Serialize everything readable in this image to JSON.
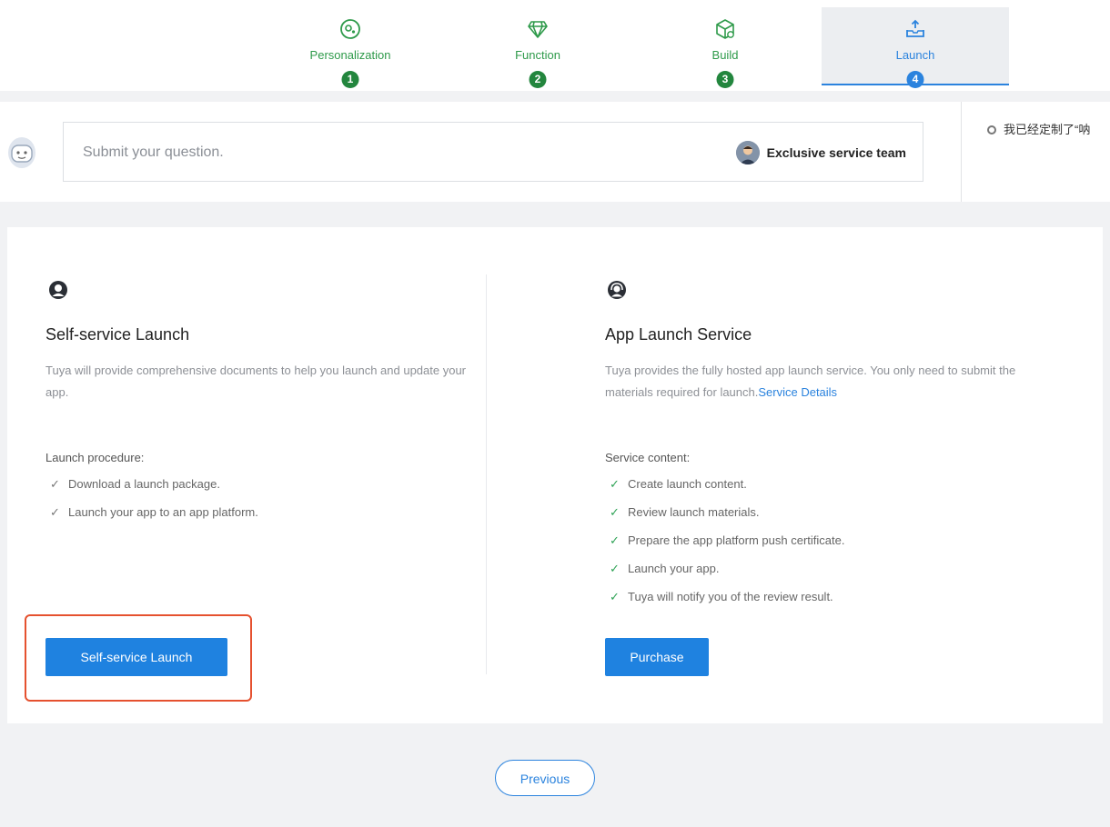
{
  "steps": [
    {
      "label": "Personalization",
      "number": "1",
      "icon": "personalization-icon",
      "state": "done"
    },
    {
      "label": "Function",
      "number": "2",
      "icon": "diamond-icon",
      "state": "done"
    },
    {
      "label": "Build",
      "number": "3",
      "icon": "box-icon",
      "state": "done"
    },
    {
      "label": "Launch",
      "number": "4",
      "icon": "upload-tray-icon",
      "state": "active"
    }
  ],
  "question": {
    "placeholder": "Submit your question.",
    "team_label": "Exclusive service team",
    "side_ticker": "我已经定制了“呐"
  },
  "self_service": {
    "title": "Self-service Launch",
    "description": "Tuya will provide comprehensive documents to help you launch and update your app.",
    "list_title": "Launch procedure:",
    "items": [
      "Download a launch package.",
      "Launch your app to an app platform."
    ],
    "button": "Self-service Launch"
  },
  "app_launch": {
    "title": "App Launch Service",
    "description": "Tuya provides the fully hosted app launch service. You only need to submit the materials required for launch.",
    "link": "Service Details",
    "list_title": "Service content:",
    "items": [
      "Create launch content.",
      "Review launch materials.",
      "Prepare the app platform push certificate.",
      "Launch your app.",
      "Tuya will notify you of the review result."
    ],
    "button": "Purchase"
  },
  "footer": {
    "previous": "Previous"
  },
  "colors": {
    "accent": "#1f82e0",
    "done_green": "#23863e",
    "highlight": "#e5512f"
  }
}
